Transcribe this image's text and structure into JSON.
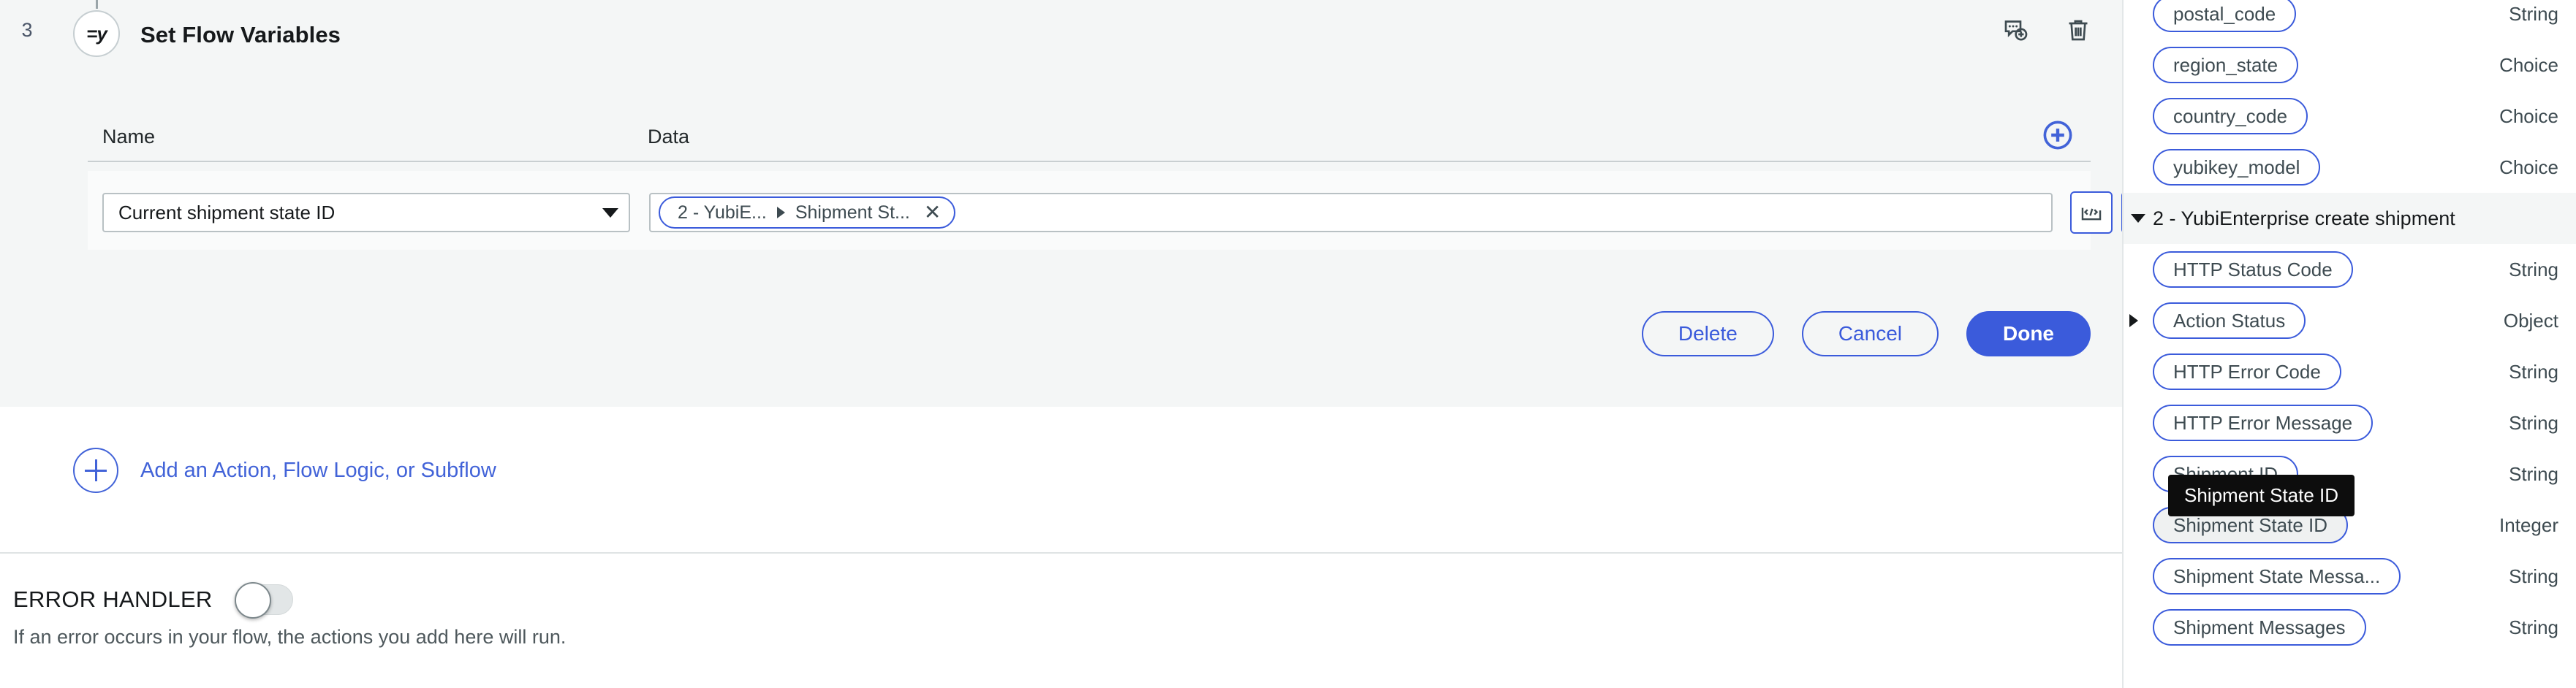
{
  "step": {
    "number": "3",
    "icon_glyph": "=y",
    "title": "Set Flow Variables",
    "header_icons": [
      {
        "name": "add-comment-icon"
      },
      {
        "name": "delete-step-icon"
      }
    ]
  },
  "table": {
    "col_name": "Name",
    "col_data": "Data",
    "add_row_label": "+",
    "rows": [
      {
        "name_value": "Current shipment state ID",
        "chip": {
          "source": "2 - YubiE...",
          "field": "Shipment St...",
          "remove_label": "✕"
        }
      }
    ]
  },
  "buttons": {
    "delete": "Delete",
    "cancel": "Cancel",
    "done": "Done"
  },
  "add_action": {
    "label": "Add an Action, Flow Logic, or Subflow"
  },
  "error_handler": {
    "title": "ERROR HANDLER",
    "toggle_state": "off",
    "description": "If an error occurs in your flow, the actions you add here will run."
  },
  "tooltip": {
    "text": "Shipment State ID"
  },
  "sidebar": {
    "top_items": [
      {
        "label": "postal_code",
        "type": "String"
      },
      {
        "label": "region_state",
        "type": "Choice"
      },
      {
        "label": "country_code",
        "type": "Choice"
      },
      {
        "label": "yubikey_model",
        "type": "Choice"
      }
    ],
    "group": {
      "title": "2 - YubiEnterprise create shipment",
      "items": [
        {
          "label": "HTTP Status Code",
          "type": "String",
          "expandable": false,
          "active": false
        },
        {
          "label": "Action Status",
          "type": "Object",
          "expandable": true,
          "active": false
        },
        {
          "label": "HTTP Error Code",
          "type": "String",
          "expandable": false,
          "active": false
        },
        {
          "label": "HTTP Error Message",
          "type": "String",
          "expandable": false,
          "active": false
        },
        {
          "label": "Shipment ID",
          "type": "String",
          "expandable": false,
          "active": false
        },
        {
          "label": "Shipment State ID",
          "type": "Integer",
          "expandable": false,
          "active": true
        },
        {
          "label": "Shipment State Messa...",
          "type": "String",
          "expandable": false,
          "active": false
        },
        {
          "label": "Shipment Messages",
          "type": "String",
          "expandable": false,
          "active": false
        }
      ]
    }
  },
  "colors": {
    "accent": "#3b5bdb",
    "link": "#4263d8",
    "panel_bg": "#f4f6f6",
    "tooltip_bg": "#0d0d0d"
  }
}
